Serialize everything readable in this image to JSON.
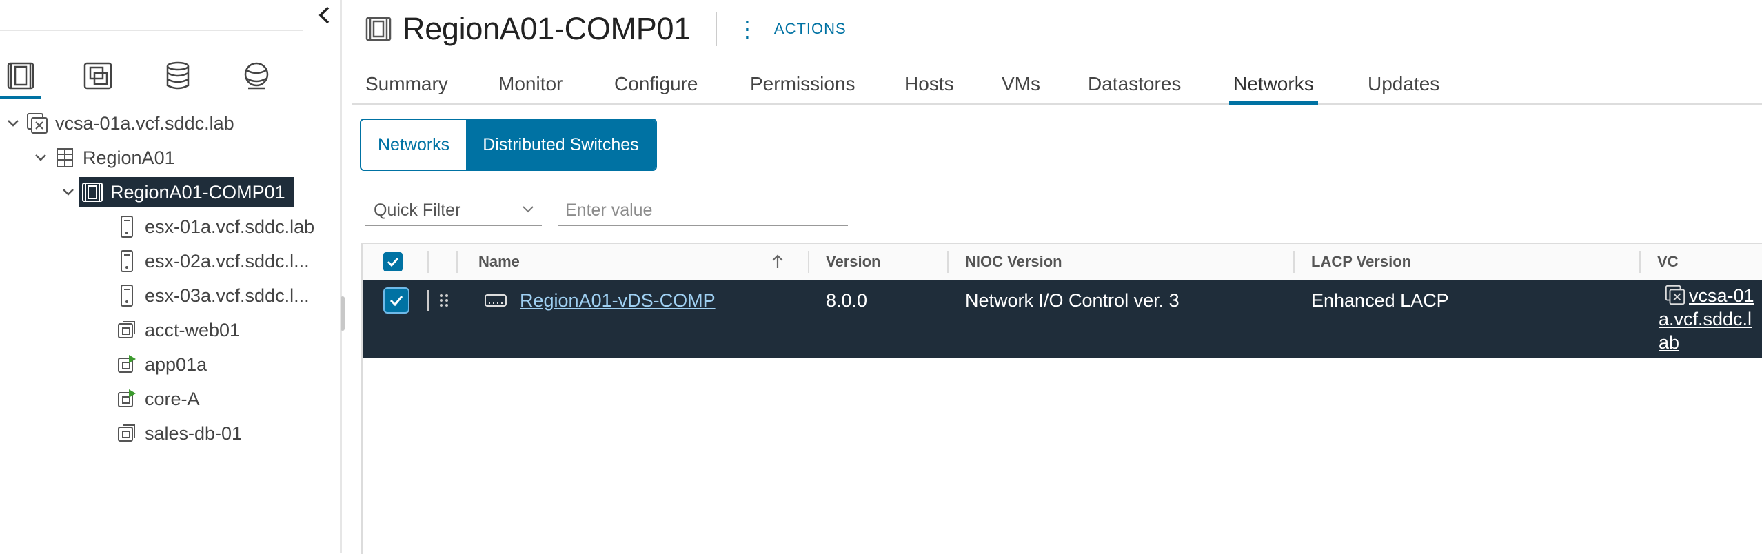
{
  "navigator": {
    "collapse_icon": "chevron-left-icon",
    "tabs": [
      {
        "name": "hosts-and-clusters",
        "icon": "host-cluster-icon",
        "active": true
      },
      {
        "name": "vms-and-templates",
        "icon": "vm-template-icon",
        "active": false
      },
      {
        "name": "storage",
        "icon": "database-icon",
        "active": false
      },
      {
        "name": "networking",
        "icon": "network-globe-icon",
        "active": false
      }
    ],
    "tree": [
      {
        "label": "vcsa-01a.vcf.sddc.lab",
        "icon": "vcenter-icon",
        "expanded": true
      },
      {
        "label": "RegionA01",
        "icon": "datacenter-icon",
        "expanded": true
      },
      {
        "label": "RegionA01-COMP01",
        "icon": "cluster-icon",
        "expanded": true,
        "selected": true
      },
      {
        "label": "esx-01a.vcf.sddc.lab",
        "icon": "host-icon"
      },
      {
        "label": "esx-02a.vcf.sddc.l...",
        "icon": "host-icon"
      },
      {
        "label": "esx-03a.vcf.sddc.l...",
        "icon": "host-icon"
      },
      {
        "label": "acct-web01",
        "icon": "vm-off-icon"
      },
      {
        "label": "app01a",
        "icon": "vm-on-icon"
      },
      {
        "label": "core-A",
        "icon": "vm-on-icon"
      },
      {
        "label": "sales-db-01",
        "icon": "vm-off-icon"
      }
    ]
  },
  "header": {
    "title": "RegionA01-COMP01",
    "actions_label": "ACTIONS"
  },
  "tabs": [
    "Summary",
    "Monitor",
    "Configure",
    "Permissions",
    "Hosts",
    "VMs",
    "Datastores",
    "Networks",
    "Updates"
  ],
  "active_tab": "Networks",
  "subtabs": [
    "Networks",
    "Distributed Switches"
  ],
  "active_subtab": "Distributed Switches",
  "filter": {
    "select_value": "Quick Filter",
    "input_placeholder": "Enter value"
  },
  "grid": {
    "columns": [
      "Name",
      "Version",
      "NIOC Version",
      "LACP Version",
      "VC"
    ],
    "sort_column": "Name",
    "sort_direction": "ascending",
    "rows": [
      {
        "name": "RegionA01-vDS-COMP",
        "version": "8.0.0",
        "nioc_version": "Network I/O Control ver. 3",
        "lacp_version": "Enhanced LACP",
        "vc": "vcsa-01a.vcf.sddc.lab",
        "selected": true
      }
    ]
  },
  "colors": {
    "accent": "#0072a3",
    "selected_row": "#1f2d3a",
    "link": "#9fd0f2"
  }
}
